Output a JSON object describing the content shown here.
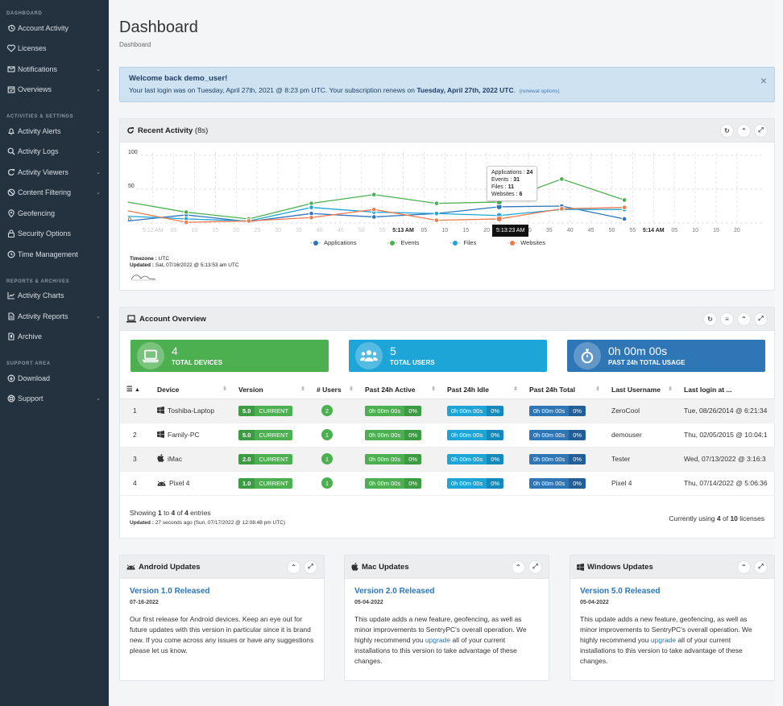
{
  "sidebar": {
    "sections": [
      {
        "title": "DASHBOARD",
        "items": [
          {
            "label": "Account Activity",
            "icon": "history-icon",
            "chevron": false
          },
          {
            "label": "Licenses",
            "icon": "license-icon",
            "chevron": false
          },
          {
            "label": "Notifications",
            "icon": "envelope-icon",
            "chevron": true
          },
          {
            "label": "Overviews",
            "icon": "calendar-check-icon",
            "chevron": true
          }
        ]
      },
      {
        "title": "ACTIVITIES & SETTINGS",
        "items": [
          {
            "label": "Activity Alerts",
            "icon": "bell-icon",
            "chevron": true
          },
          {
            "label": "Activity Logs",
            "icon": "search-icon",
            "chevron": true
          },
          {
            "label": "Activity Viewers",
            "icon": "refresh-icon",
            "chevron": true
          },
          {
            "label": "Content Filtering",
            "icon": "ban-icon",
            "chevron": true
          },
          {
            "label": "Geofencing",
            "icon": "map-pin-icon",
            "chevron": false
          },
          {
            "label": "Security Options",
            "icon": "lock-icon",
            "chevron": false
          },
          {
            "label": "Time Management",
            "icon": "clock-icon",
            "chevron": false
          }
        ]
      },
      {
        "title": "REPORTS & ARCHIVES",
        "items": [
          {
            "label": "Activity Charts",
            "icon": "line-chart-icon",
            "chevron": false
          },
          {
            "label": "Activity Reports",
            "icon": "file-icon",
            "chevron": true
          },
          {
            "label": "Archive",
            "icon": "archive-file-icon",
            "chevron": false
          }
        ]
      },
      {
        "title": "SUPPORT AREA",
        "items": [
          {
            "label": "Download",
            "icon": "download-icon",
            "chevron": false
          },
          {
            "label": "Support",
            "icon": "life-ring-icon",
            "chevron": true
          }
        ]
      }
    ]
  },
  "header": {
    "title": "Dashboard",
    "breadcrumb": "Dashboard"
  },
  "alert": {
    "title": "Welcome back demo_user!",
    "text_prefix": "Your last login was on Tuesday, April 27th, 2021 @ 8:23 pm UTC.  Your subscription renews on ",
    "renew_date": "Tuesday, April 27th, 2022 UTC",
    "text_suffix": ".",
    "renewal_link": "(renewal options)",
    "close": "×"
  },
  "recent_activity": {
    "title": "Recent Activity",
    "interval": "(8s)",
    "timezone_label": "Timezone :",
    "timezone": "UTC",
    "updated_label": "Updated :",
    "updated": "Sat, 07/16/2022 @ 5:13:53 am UTC",
    "tooltip": {
      "rows": [
        {
          "label": "Applications",
          "value": "24"
        },
        {
          "label": "Events",
          "value": "31"
        },
        {
          "label": "Files",
          "value": "11"
        },
        {
          "label": "Websites",
          "value": "6"
        }
      ],
      "x_label": "5:13:23 AM"
    }
  },
  "chart_data": {
    "type": "line",
    "title": "",
    "xlabel": "",
    "ylabel": "",
    "ylim": [
      0,
      100
    ],
    "yticks": [
      0,
      50,
      100
    ],
    "grid": true,
    "legend": "bottom-center",
    "x_ticks": [
      "5:12 AM",
      "05",
      "10",
      "15",
      "20",
      "25",
      "30",
      "35",
      "40",
      "45",
      "50",
      "55",
      "5:13 AM",
      "05",
      "10",
      "15",
      "20",
      "25",
      "30",
      "35",
      "40",
      "45",
      "50",
      "55",
      "5:14 AM",
      "05",
      "10",
      "15",
      "20"
    ],
    "x_ticks_seconds": [
      0,
      5,
      10,
      15,
      20,
      25,
      30,
      35,
      40,
      45,
      50,
      55,
      60,
      65,
      70,
      75,
      80,
      85,
      90,
      95,
      100,
      105,
      110,
      115,
      120,
      125,
      130,
      135,
      140
    ],
    "x": [
      -6,
      8,
      23,
      38,
      53,
      68,
      83,
      98,
      113
    ],
    "series": [
      {
        "name": "Applications",
        "color": "#2e74c0",
        "values": [
          3,
          12,
          2,
          14,
          9,
          14,
          24,
          25,
          6
        ]
      },
      {
        "name": "Events",
        "color": "#4caf50",
        "values": [
          31,
          16,
          6,
          29,
          42,
          29,
          31,
          65,
          34
        ]
      },
      {
        "name": "Files",
        "color": "#1ea5d8",
        "values": [
          10,
          6,
          3,
          23,
          16,
          14,
          11,
          20,
          20
        ]
      },
      {
        "name": "Websites",
        "color": "#ef7b4d",
        "values": [
          18,
          1,
          3,
          8,
          20,
          4,
          6,
          21,
          23
        ]
      }
    ]
  },
  "account_overview": {
    "title": "Account Overview",
    "stats": [
      {
        "value": "4",
        "label": "TOTAL DEVICES",
        "color": "#4caf50",
        "icon": "laptop-icon"
      },
      {
        "value": "5",
        "label": "TOTAL USERS",
        "color": "#1ea5d8",
        "icon": "users-icon"
      },
      {
        "value": "0h 00m 00s",
        "label": "PAST 24h TOTAL USAGE",
        "color": "#2e76b6",
        "icon": "stopwatch-icon"
      }
    ],
    "columns": [
      "Device",
      "Version",
      "# Users",
      "Past 24h Active",
      "Past 24h Idle",
      "Past 24h Total",
      "Last Username",
      "Last login at ..."
    ],
    "rows": [
      {
        "n": "1",
        "os": "windows",
        "device": "Toshiba-Laptop",
        "version": "5.0",
        "status": "CURRENT",
        "users": "2",
        "active": "0h 00m 00s",
        "active_pct": "0%",
        "idle": "0h 00m 00s",
        "idle_pct": "0%",
        "total": "0h 00m 00s",
        "total_pct": "0%",
        "username": "ZeroCool",
        "last_login": "Tue, 08/26/2014 @ 6:21:34"
      },
      {
        "n": "2",
        "os": "windows",
        "device": "Family-PC",
        "version": "5.0",
        "status": "CURRENT",
        "users": "1",
        "active": "0h 00m 00s",
        "active_pct": "0%",
        "idle": "0h 00m 00s",
        "idle_pct": "0%",
        "total": "0h 00m 00s",
        "total_pct": "0%",
        "username": "demouser",
        "last_login": "Thu, 02/05/2015 @ 10:04:1"
      },
      {
        "n": "3",
        "os": "apple",
        "device": "iMac",
        "version": "2.0",
        "status": "CURRENT",
        "users": "1",
        "active": "0h 00m 00s",
        "active_pct": "0%",
        "idle": "0h 00m 00s",
        "idle_pct": "0%",
        "total": "0h 00m 00s",
        "total_pct": "0%",
        "username": "Tester",
        "last_login": "Wed, 07/13/2022 @ 3:16:3"
      },
      {
        "n": "4",
        "os": "android",
        "device": "Pixel 4",
        "version": "1.0",
        "status": "CURRENT",
        "users": "1",
        "active": "0h 00m 00s",
        "active_pct": "0%",
        "idle": "0h 00m 00s",
        "idle_pct": "0%",
        "total": "0h 00m 00s",
        "total_pct": "0%",
        "username": "Pixel 4",
        "last_login": "Thu, 07/14/2022 @ 5:06:36"
      }
    ],
    "showing": {
      "prefix": "Showing ",
      "from": "1",
      "to_word": " to ",
      "to": "4",
      "of_word": " of ",
      "total": "4",
      "suffix": " entries"
    },
    "updated_label": "Updated :",
    "updated": "27 seconds ago (Sun, 07/17/2022 @ 12:08:48 pm UTC)",
    "licenses": {
      "prefix": "Currently using ",
      "used": "4",
      "of_word": " of ",
      "total": "10",
      "suffix": " licenses"
    }
  },
  "updates": [
    {
      "title": "Android Updates",
      "icon": "android-icon",
      "release": "Version 1.0 Released",
      "date": "07-16-2022",
      "body_before": "Our first release for Android devices.  Keep an eye out for future updates with this version in particular since it is brand new.  If you come across any issues or have any suggestions please let us know.",
      "link": "",
      "body_after": ""
    },
    {
      "title": "Mac Updates",
      "icon": "apple-icon",
      "release": "Version 2.0 Released",
      "date": "05-04-2022",
      "body_before": "This update adds a new feature, geofencing, as well as minor improvements to SentryPC's overall operation.  We highly recommend you ",
      "link": "upgrade",
      "body_after": " all of your current installations to this version to take advantage of these changes."
    },
    {
      "title": "Windows Updates",
      "icon": "windows-icon",
      "release": "Version 5.0 Released",
      "date": "05-04-2022",
      "body_before": "This update adds a new feature, geofencing, as well as minor improvements to SentryPC's overall operation.  We highly recommend you ",
      "link": "upgrade",
      "body_after": " all of your current installations to this version to take advantage of these changes."
    }
  ]
}
